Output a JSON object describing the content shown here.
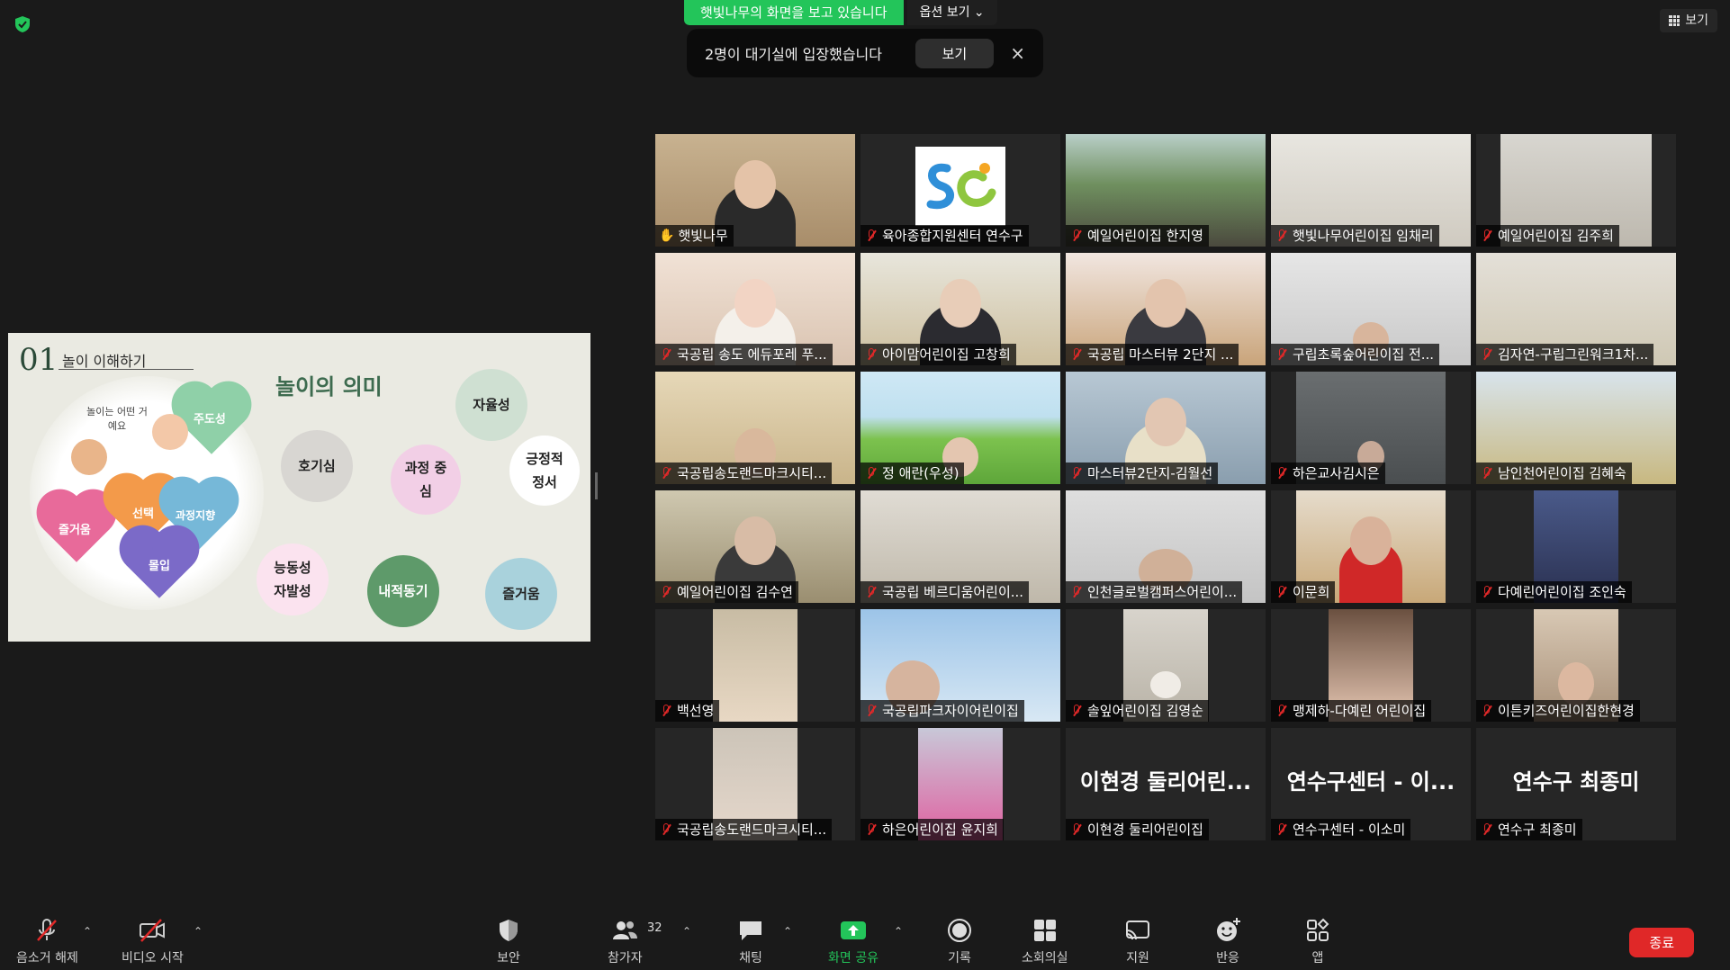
{
  "top": {
    "share_banner": "햇빛나무의 화면을 보고 있습니다",
    "share_options": "옵션 보기 ⌄",
    "view_button": "보기",
    "notification": {
      "message": "2명이 대기실에 입장했습니다",
      "button": "보기",
      "close": "×"
    }
  },
  "slide": {
    "number": "01",
    "section": "놀이 이해하기",
    "title": "놀이의 의미",
    "left_caption": "놀이는 어떤 거예요",
    "hearts": [
      "주도성",
      "즐거움",
      "선택",
      "과정지향",
      "몰입"
    ],
    "bubbles": [
      "자율성",
      "호기심",
      "과정 중심",
      "긍정적 정서",
      "능동성 자발성",
      "내적동기",
      "즐거움"
    ]
  },
  "participants": [
    {
      "name": "햇빛나무",
      "host": true
    },
    {
      "name": "육아종합지원센터 연수구"
    },
    {
      "name": "예일어린이집 한지영"
    },
    {
      "name": "햇빛나무어린이집 임채리"
    },
    {
      "name": "예일어린이집 김주희"
    },
    {
      "name": "국공립 송도 에듀포레 푸..."
    },
    {
      "name": "아이맘어린이집 고창희"
    },
    {
      "name": "국공립 마스터뷰 2단지 ..."
    },
    {
      "name": "구립초록숲어린이집 전..."
    },
    {
      "name": "김자연-구립그린워크1차..."
    },
    {
      "name": "국공립송도랜드마크시티..."
    },
    {
      "name": "정 애란(우성)"
    },
    {
      "name": "마스터뷰2단지-김월선"
    },
    {
      "name": "하은교사김시은"
    },
    {
      "name": "남인천어린이집 김혜숙"
    },
    {
      "name": "예일어린이집 김수연"
    },
    {
      "name": "국공립 베르디움어린이..."
    },
    {
      "name": "인천글로벌캠퍼스어린이..."
    },
    {
      "name": "이문희"
    },
    {
      "name": "다예린어린이집 조인숙"
    },
    {
      "name": "백선영"
    },
    {
      "name": "국공립파크자이어린이집"
    },
    {
      "name": "솔잎어린이집 김영순"
    },
    {
      "name": "맹제하-다예린 어린이집"
    },
    {
      "name": "이튼키즈어린이집한현경"
    },
    {
      "name": "국공립송도랜드마크시티..."
    },
    {
      "name": "하은어린이집 윤지희"
    },
    {
      "name": "이현경 둘리어린이집",
      "display": "이현경 둘리어린..."
    },
    {
      "name": "연수구센터 - 이소미",
      "display": "연수구센터 - 이..."
    },
    {
      "name": "연수구 최종미",
      "display": "연수구 최종미"
    }
  ],
  "toolbar": {
    "unmute": "음소거 해제",
    "start_video": "비디오 시작",
    "security": "보안",
    "participants": "참가자",
    "participant_count": "32",
    "chat": "채팅",
    "share": "화면 공유",
    "record": "기록",
    "breakout": "소회의실",
    "whiteboard": "지원",
    "reactions": "반응",
    "apps": "앱",
    "end": "종료"
  },
  "colors": {
    "share_green": "#23c55a",
    "active_speaker": "#c8e64a",
    "end_red": "#e02828",
    "muted_red": "#e02828"
  }
}
